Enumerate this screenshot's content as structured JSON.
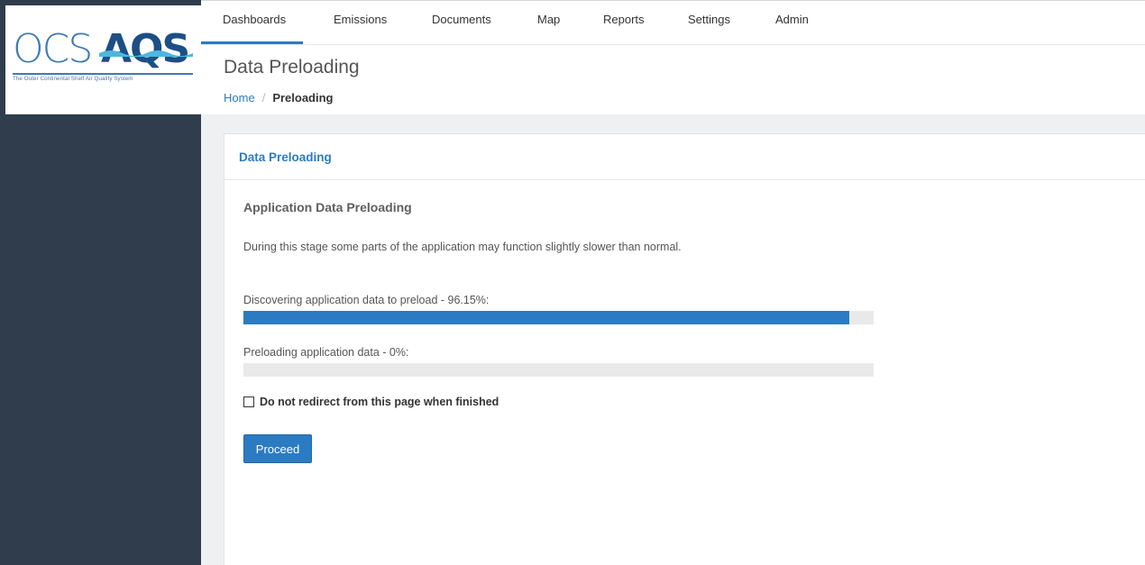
{
  "brand": {
    "logo_ocs": "OCS",
    "logo_aqs": "AQS",
    "tagline": "The Outer Continental Shelf Air Quality System",
    "primary_color": "#2b7bc2",
    "sidebar_color": "#2f3d4c"
  },
  "nav": {
    "items": [
      {
        "label": "Dashboards",
        "active": true
      },
      {
        "label": "Emissions"
      },
      {
        "label": "Documents"
      },
      {
        "label": "Map"
      },
      {
        "label": "Reports"
      },
      {
        "label": "Settings"
      },
      {
        "label": "Admin"
      }
    ]
  },
  "header": {
    "title": "Data Preloading",
    "breadcrumb": {
      "home": "Home",
      "separator": "/",
      "current": "Preloading"
    }
  },
  "panel": {
    "heading": "Data Preloading",
    "section_title": "Application Data Preloading",
    "description": "During this stage some parts of the application may function slightly slower than normal.",
    "progress": [
      {
        "label": "Discovering application data to preload - 96.15%:",
        "percent": 96.15
      },
      {
        "label": "Preloading application data - 0%:",
        "percent": 0
      }
    ],
    "checkbox": {
      "label": "Do not redirect from this page when finished",
      "checked": false
    },
    "proceed_label": "Proceed"
  }
}
